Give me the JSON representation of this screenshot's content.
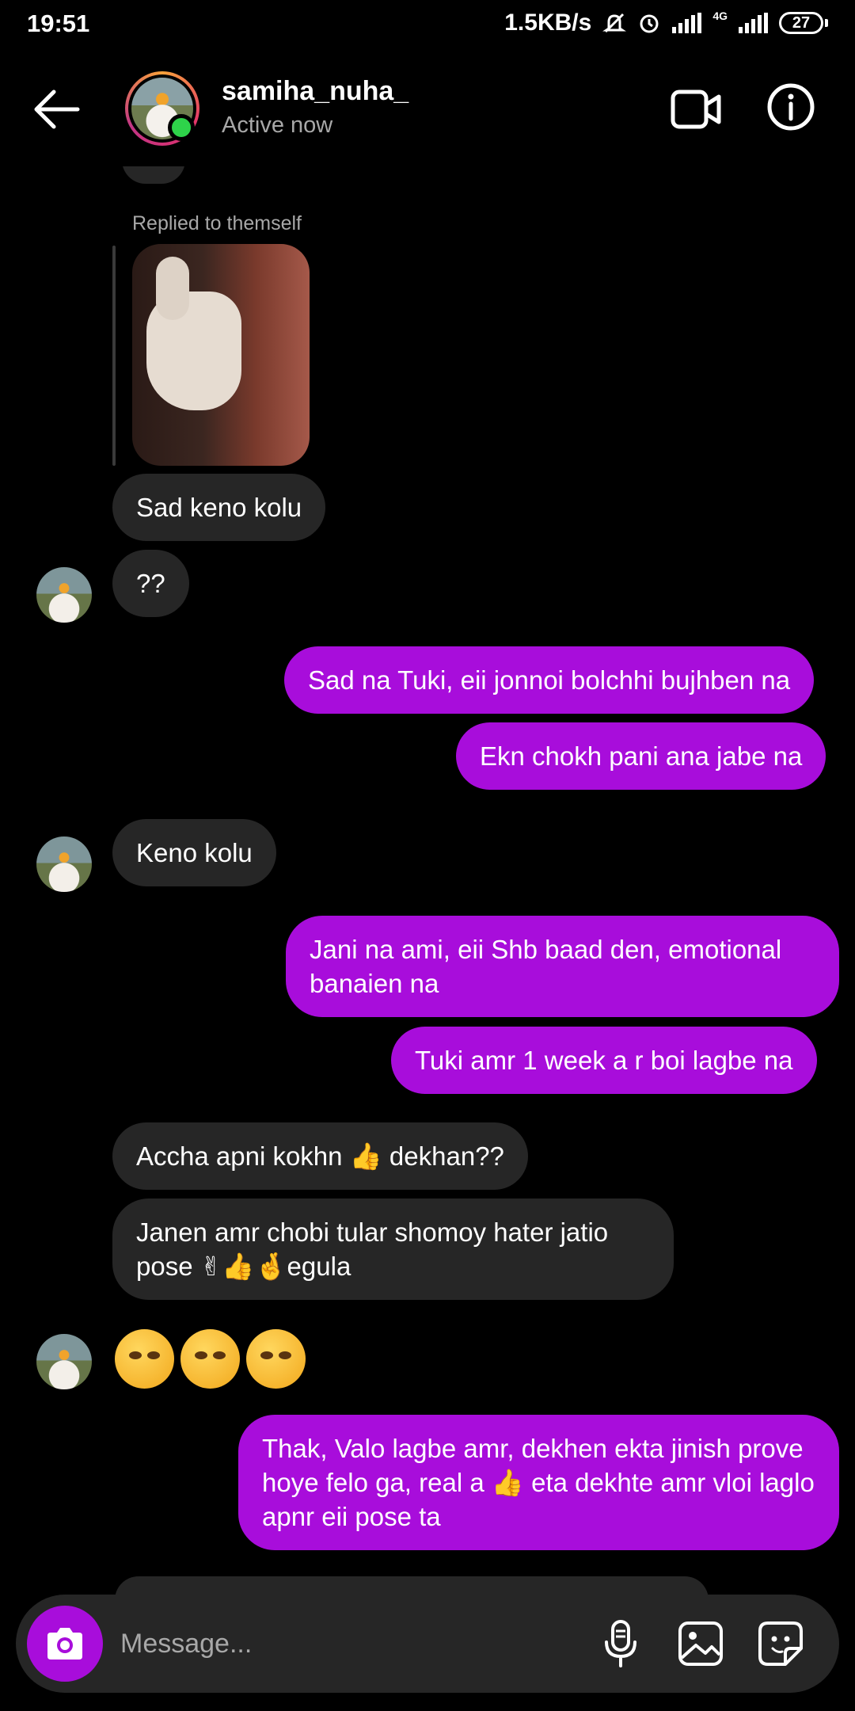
{
  "status_bar": {
    "time": "19:51",
    "network_speed": "1.5KB/s",
    "network_type": "4G",
    "battery": "27"
  },
  "header": {
    "username": "samiha_nuha_",
    "status": "Active now"
  },
  "reply": {
    "label": "Replied to themself"
  },
  "messages": [
    {
      "from": "them",
      "text": "Sad keno kolu"
    },
    {
      "from": "them",
      "text": "??"
    },
    {
      "from": "me",
      "text": "Sad na Tuki, eii jonnoi bolchhi bujhben na"
    },
    {
      "from": "me",
      "text": "Ekn chokh pani ana jabe na"
    },
    {
      "from": "them",
      "text": "Keno kolu"
    },
    {
      "from": "me",
      "text": "Jani na ami, eii Shb baad den, emotional banaien na"
    },
    {
      "from": "me",
      "text": "Tuki amr 1 week a r boi lagbe na"
    },
    {
      "from": "them",
      "text": "Accha apni kokhn 👍 dekhan??"
    },
    {
      "from": "them",
      "text": "Janen amr chobi tular shomoy hater jatio pose ✌👍🤞egula"
    },
    {
      "from": "them",
      "text": "🥴🥴🥴"
    },
    {
      "from": "me",
      "text": "Thak, Valo lagbe amr, dekhen ekta jinish prove hoye felo ga, real a 👍 eta dekhte amr vloi laglo apnr eii pose ta"
    }
  ],
  "composer": {
    "placeholder": "Message..."
  },
  "colors": {
    "outgoing_bubble": "#a80ddb",
    "incoming_bubble": "#262626",
    "online": "#2ed34a"
  }
}
